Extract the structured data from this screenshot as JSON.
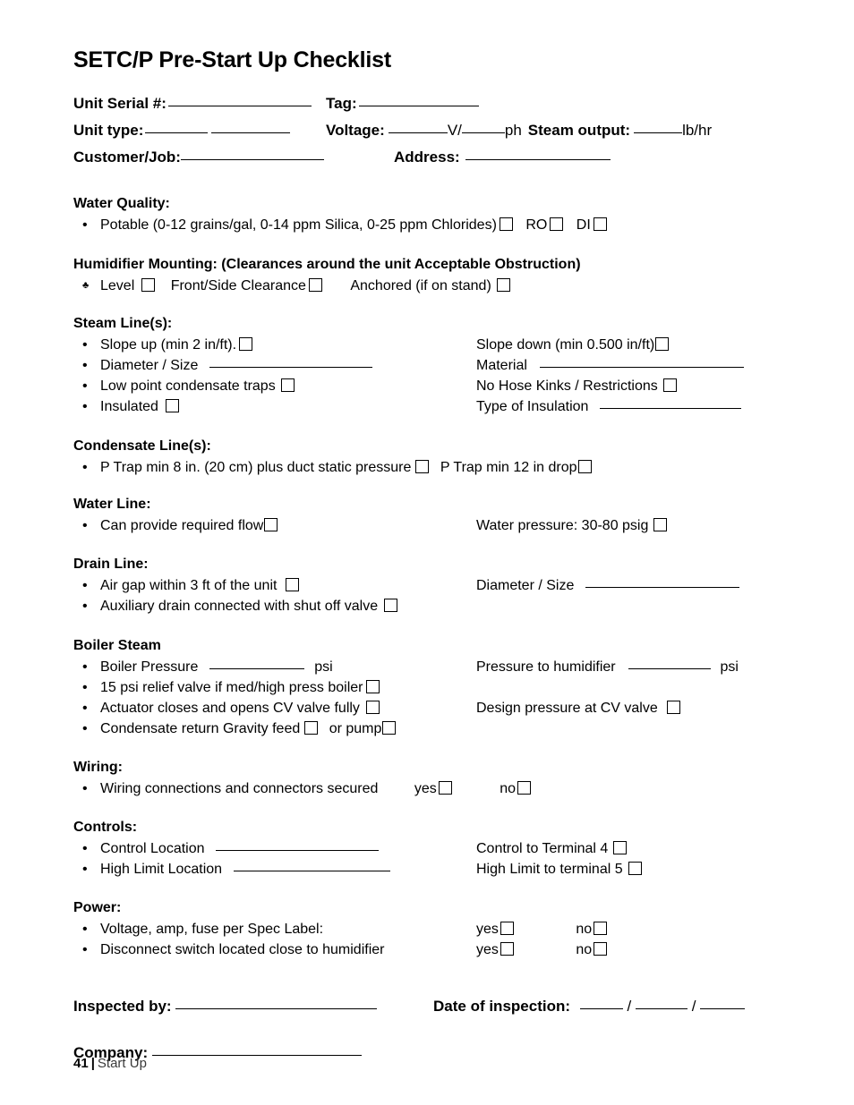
{
  "document": {
    "title": "SETC/P Pre-Start Up Checklist"
  },
  "header_fields": {
    "unit_serial_label": "Unit Serial #:",
    "tag_label": "Tag:",
    "unit_type_label": "Unit type:",
    "voltage_label": "Voltage:",
    "voltage_unit_v": "V/",
    "voltage_unit_ph": "ph",
    "steam_output_label": "Steam output:",
    "steam_output_unit": "lb/hr",
    "customer_job_label": "Customer/Job:",
    "address_label": "Address:"
  },
  "sections": [
    {
      "heading": "Water Quality:",
      "rows": [
        {
          "bullet": "•",
          "left_text": "Potable (0-12 grains/gal, 0-14 ppm Silica, 0-25 ppm Chlorides)",
          "inline_after": [
            "RO",
            "DI"
          ]
        }
      ]
    },
    {
      "heading": "Humidifier Mounting: (Clearances around the unit Acceptable Obstruction)",
      "rows": [
        {
          "bullet": "♣",
          "items": [
            "Level",
            "Front/Side Clearance",
            "Anchored (if on stand)"
          ]
        }
      ]
    },
    {
      "heading": "Steam Line(s):",
      "rows": [
        {
          "bullet": "•",
          "left": "Slope up (min 2 in/ft).",
          "right": "Slope down (min 0.500 in/ft)"
        },
        {
          "bullet": "•",
          "left": "Diameter / Size",
          "right": "Material"
        },
        {
          "bullet": "•",
          "left": "Low point condensate traps",
          "right": "No Hose Kinks / Restrictions"
        },
        {
          "bullet": "•",
          "left": "Insulated",
          "right": "Type of Insulation"
        }
      ]
    },
    {
      "heading": "Condensate Line(s):",
      "rows": [
        {
          "bullet": "•",
          "left": "P Trap min 8 in. (20 cm) plus duct static pressure",
          "right": "P Trap min 12 in drop"
        }
      ]
    },
    {
      "heading": "Water Line:",
      "rows": [
        {
          "bullet": "•",
          "left": "Can provide required flow",
          "right": "Water pressure: 30-80 psig"
        }
      ]
    },
    {
      "heading": "Drain Line:",
      "rows": [
        {
          "bullet": "•",
          "left": "Air gap within 3 ft of the unit",
          "right": "Diameter / Size"
        },
        {
          "bullet": "•",
          "left": "Auxiliary drain connected with shut off valve",
          "right": ""
        }
      ]
    },
    {
      "heading": "Boiler Steam",
      "rows": [
        {
          "bullet": "•",
          "left": "Boiler Pressure",
          "left_unit": "psi",
          "right": "Pressure to humidifier",
          "right_unit": "psi"
        },
        {
          "bullet": "•",
          "left": "15 psi relief valve if med/high press boiler",
          "right": ""
        },
        {
          "bullet": "•",
          "left": "Actuator closes and opens CV valve fully",
          "right": "Design pressure at CV valve"
        },
        {
          "bullet": "•",
          "left": "Condensate return Gravity feed",
          "left_extra": "or pump",
          "right": ""
        }
      ]
    },
    {
      "heading": "Wiring:",
      "rows": [
        {
          "bullet": "•",
          "left": "Wiring connections and connectors secured",
          "yes": "yes",
          "no": "no"
        }
      ]
    },
    {
      "heading": "Controls:",
      "rows": [
        {
          "bullet": "•",
          "left": "Control Location",
          "right": "Control to Terminal 4"
        },
        {
          "bullet": "•",
          "left": "High Limit Location",
          "right": "High Limit to terminal 5"
        }
      ]
    },
    {
      "heading": "Power:",
      "rows": [
        {
          "bullet": "•",
          "left": "Voltage, amp, fuse per Spec Label:",
          "yes": "yes",
          "no": "no"
        },
        {
          "bullet": "•",
          "left": "Disconnect switch located close to humidifier",
          "yes": "yes",
          "no": "no"
        }
      ]
    }
  ],
  "signature": {
    "inspected_by_label": "Inspected by:",
    "date_label": "Date of inspection:",
    "date_sep": "/",
    "company_label": "Company:"
  },
  "footer": {
    "page_number": "41",
    "separator": "|",
    "section_name": "Start Up"
  }
}
